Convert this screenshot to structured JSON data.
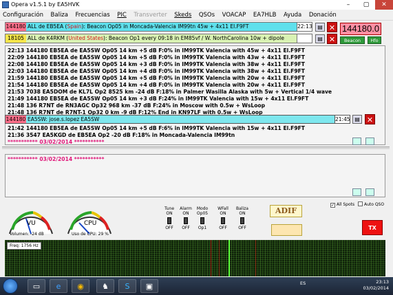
{
  "window": {
    "title": "Opera v1.5.1    by EA5HVK"
  },
  "menu": [
    {
      "label": "Configuración",
      "disabled": false
    },
    {
      "label": "Baliza",
      "disabled": false
    },
    {
      "label": "Frecuencias",
      "disabled": false
    },
    {
      "label": "PIC",
      "disabled": false
    },
    {
      "label": "Transverter",
      "disabled": true
    },
    {
      "label": "Skeds",
      "disabled": false
    },
    {
      "label": "QSOs",
      "disabled": false
    },
    {
      "label": "VOACAP",
      "disabled": false
    },
    {
      "label": "EA7HLB",
      "disabled": false
    },
    {
      "label": "Ayuda",
      "disabled": false
    },
    {
      "label": "Donación",
      "disabled": false
    }
  ],
  "beacon1": {
    "freq": "144180",
    "pre": "ALL de EB5EA (",
    "country": "Spain",
    "post": "): Beacon Op05 in Moncada-Valencia IM99tn 45w + 4x11 El.F9FT",
    "time": "22:13"
  },
  "beacon2": {
    "freq": "18105",
    "pre": "ALL de K4RKM (",
    "country": "United States",
    "post": "): Beacon Op1 every 09:18 in EM85vf / W. NorthCarolina 10w + dipole",
    "time": ""
  },
  "freq_display": "144180.0",
  "beacon_btn": "Beacon",
  "hfo_btn": "Hfo",
  "log_lines": [
    "22:13 144180 EB5EA de EA5SW Op05 14 km +5 dB F:0% in IM99TK Valencia with 45w + 4x11 El.F9FT",
    "22:09 144180 EB5EA de EA5SW Op05 14 km +5 dB F:0% in IM99TK Valencia with 43w + 4x11 El.F9FT",
    "22:08 144180 EB5EA de EA5SW Op05 14 km +3 dB F:0% in IM99TK Valencia with 38w + 4x11 El.F9FT",
    "22:03 144180 EB5EA de EA5SW Op05 14 km +4 dB F:0% in IM99TK Valencia with 38w + 4x11 El.F9FT",
    "21:59 144180 EB5EA de EA5SW Op05 14 km +5 dB F:0% in IM99TK Valencia with 20w + 4x11 El.F9FT",
    "21:54 144180 EB5EA de EA5SW Op05 14 km +4 dB F:0% in IM99TK Valencia with 20w + 4x11 El.F9FT",
    "21:53   7038 EA5DOM de KL7L Op2 8525 km -24 dB F:18% in Palmer Wasilla Alaska with 5w + Vertical 1/4 wave",
    "21:49 144180 EB5EA de EA5SW Op05 14 km +3 dB F:24% in IM99TK Valencia with 15w + 4x11 El.F9FT",
    "21:48     136 R7NT de RN3AGC Op32 968 km -37 dB F:24% in Moscow with 0.5w + WsLoop",
    "21:48     136 R7NT de R7NT-1 Op32 0 km -9 dB F:12%  End in KN97LF with 0.5w + WsLoop"
  ],
  "chat": {
    "freq": "144180",
    "text": "EA5SW: jose.s.lopez EA5SW",
    "time": "21:45"
  },
  "log_lines2": [
    "21:42 144180 EB5EA de EA5SW Op05 14 km +5 dB F:6% in IM99TK Valencia with 15w + 4x11 El.F9FT",
    "21:36   3547 EA5KGD de EB5EA Op2 -20 dB F:18% in Moncada-Valencia IM99tn"
  ],
  "date_line": "*********** 03/02/2014 ***********",
  "date_line2": "*********** 03/02/2014 ***********",
  "gauges": {
    "vu": {
      "label": "VU",
      "caption": "Volumen: -24 dB"
    },
    "cpu": {
      "label": "CPU",
      "caption": "Uso de CPU: 29 %"
    }
  },
  "toggles": [
    {
      "title": "Tune",
      "top": "ON",
      "bottom": "OFF"
    },
    {
      "title": "Alarm",
      "top": "ON",
      "bottom": "OFF"
    },
    {
      "title": "Modo",
      "top": "Op05",
      "bottom": "Op1"
    },
    {
      "title": "WFall",
      "top": "ON",
      "bottom": "OFF"
    },
    {
      "title": "Baliza",
      "top": "ON",
      "bottom": "OFF"
    }
  ],
  "adif": "ADIF",
  "all_spots": "All Spots",
  "auto_qso": "Auto QSO",
  "tx": "TX",
  "waterfall": {
    "freq_label": "Freq: 1756 Hz"
  },
  "taskbar": {
    "lang": "ES",
    "time": "23:13",
    "date": "03/02/2014"
  }
}
